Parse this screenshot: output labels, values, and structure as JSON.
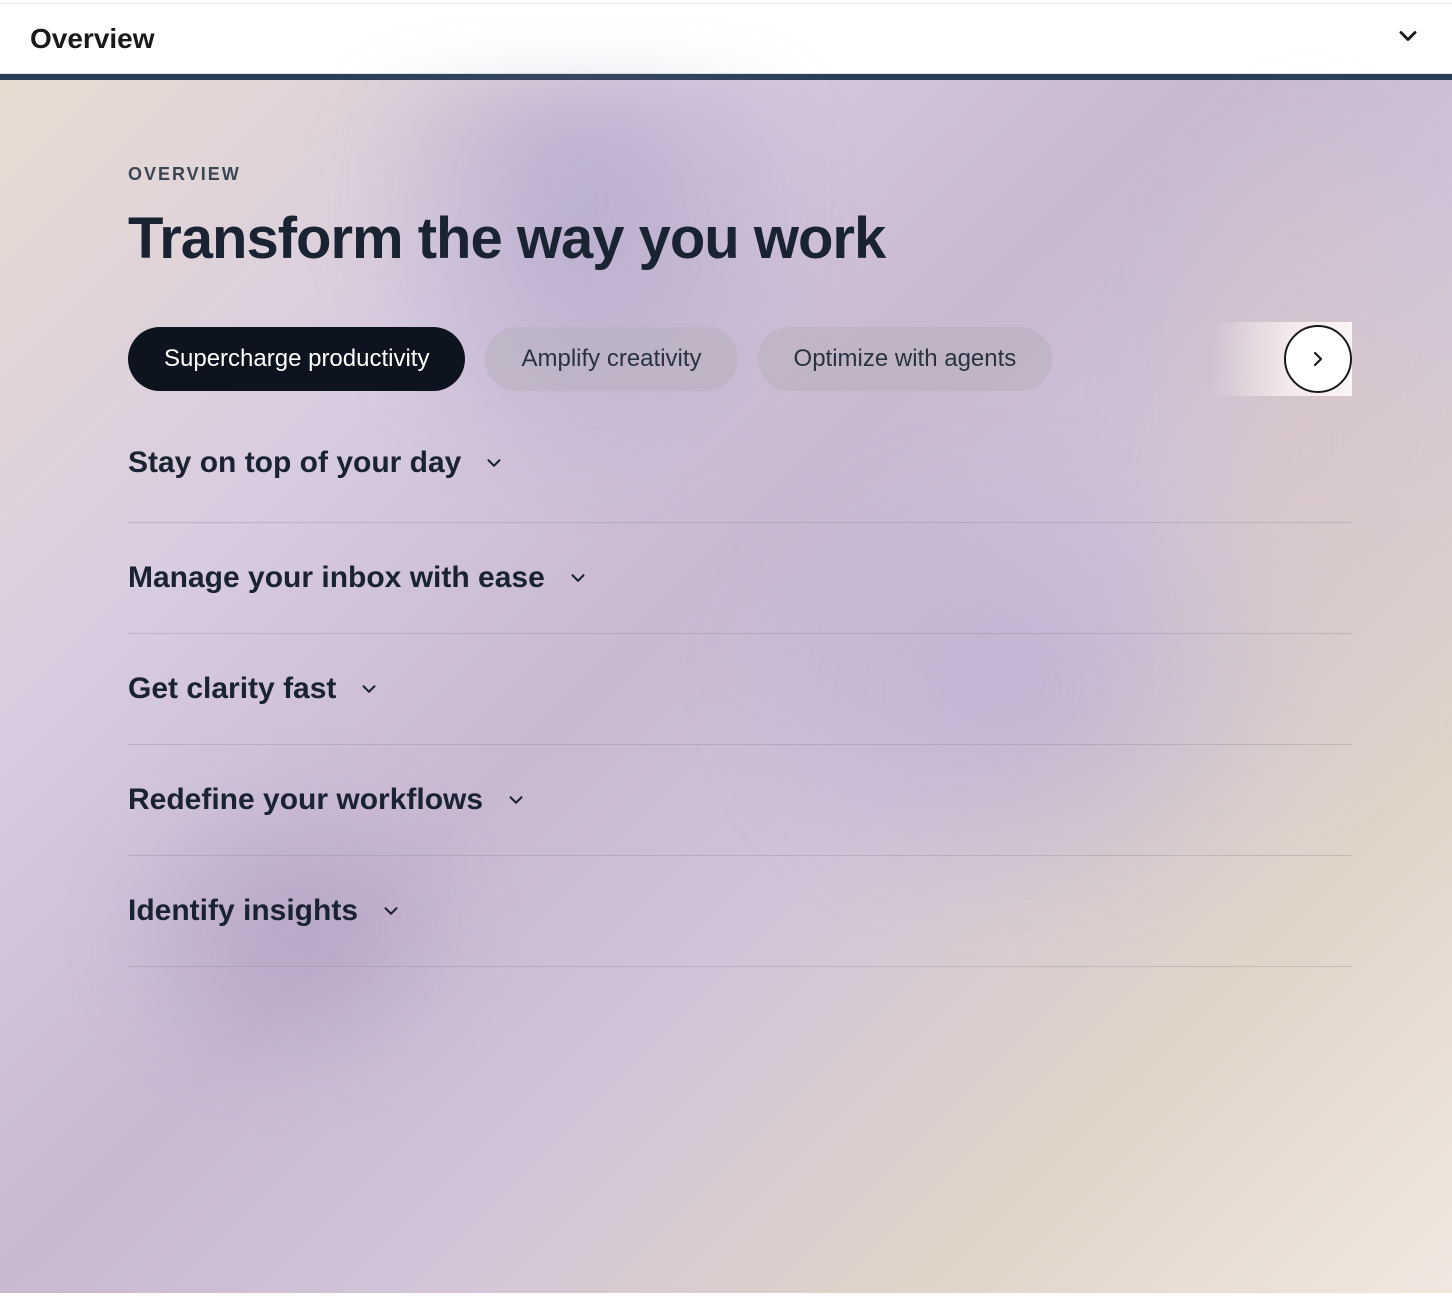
{
  "header": {
    "title": "Overview"
  },
  "overview": {
    "eyebrow": "OVERVIEW",
    "heading": "Transform the way you work"
  },
  "tabs": [
    {
      "label": "Supercharge productivity",
      "active": true
    },
    {
      "label": "Amplify creativity",
      "active": false
    },
    {
      "label": "Optimize with agents",
      "active": false
    }
  ],
  "accordion": [
    {
      "title": "Stay on top of your day"
    },
    {
      "title": "Manage your inbox with ease"
    },
    {
      "title": "Get clarity fast"
    },
    {
      "title": "Redefine your workflows"
    },
    {
      "title": "Identify insights"
    }
  ],
  "colors": {
    "dark_navy": "#1a2332",
    "pill_active_bg": "#0d1420",
    "accent_bar": "#2c3e58"
  }
}
